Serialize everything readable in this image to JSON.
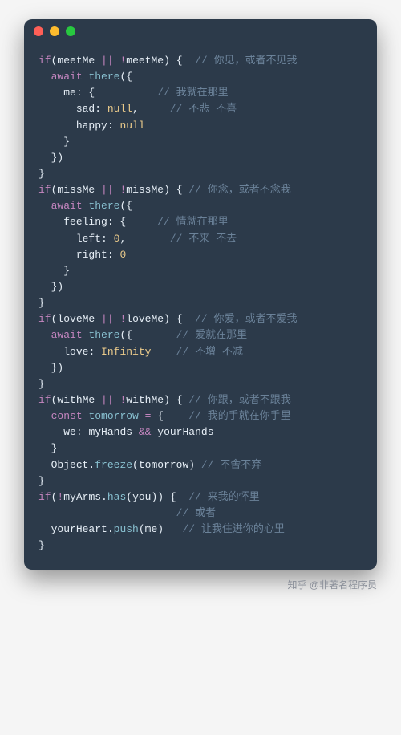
{
  "window": {
    "traffic_lights": [
      "red",
      "yellow",
      "green"
    ]
  },
  "code": {
    "lines": [
      {
        "tokens": [
          [
            "kw",
            "if"
          ],
          [
            "pun",
            "("
          ],
          [
            "id",
            "meetMe"
          ],
          [
            "pun",
            " "
          ],
          [
            "op",
            "||"
          ],
          [
            "pun",
            " "
          ],
          [
            "op",
            "!"
          ],
          [
            "id",
            "meetMe"
          ],
          [
            "pun",
            ") {"
          ]
        ],
        "cmt": "  // 你见，或者不见我"
      },
      {
        "tokens": [
          [
            "pun",
            "  "
          ],
          [
            "kw",
            "await"
          ],
          [
            "pun",
            " "
          ],
          [
            "fn",
            "there"
          ],
          [
            "pun",
            "({"
          ]
        ],
        "cmt": ""
      },
      {
        "tokens": [
          [
            "pun",
            "    "
          ],
          [
            "id",
            "me"
          ],
          [
            "pun",
            ": {"
          ]
        ],
        "cmt": "          // 我就在那里"
      },
      {
        "tokens": [
          [
            "pun",
            "      "
          ],
          [
            "id",
            "sad"
          ],
          [
            "pun",
            ": "
          ],
          [
            "num",
            "null"
          ],
          [
            "pun",
            ","
          ]
        ],
        "cmt": "     // 不悲 不喜"
      },
      {
        "tokens": [
          [
            "pun",
            "      "
          ],
          [
            "id",
            "happy"
          ],
          [
            "pun",
            ": "
          ],
          [
            "num",
            "null"
          ]
        ],
        "cmt": ""
      },
      {
        "tokens": [
          [
            "pun",
            "    }"
          ]
        ],
        "cmt": ""
      },
      {
        "tokens": [
          [
            "pun",
            "  })"
          ]
        ],
        "cmt": ""
      },
      {
        "tokens": [
          [
            "pun",
            "}"
          ]
        ],
        "cmt": ""
      },
      {
        "tokens": [
          [
            "pun",
            ""
          ]
        ],
        "cmt": ""
      },
      {
        "tokens": [
          [
            "kw",
            "if"
          ],
          [
            "pun",
            "("
          ],
          [
            "id",
            "missMe"
          ],
          [
            "pun",
            " "
          ],
          [
            "op",
            "||"
          ],
          [
            "pun",
            " "
          ],
          [
            "op",
            "!"
          ],
          [
            "id",
            "missMe"
          ],
          [
            "pun",
            ") {"
          ]
        ],
        "cmt": " // 你念，或者不念我"
      },
      {
        "tokens": [
          [
            "pun",
            "  "
          ],
          [
            "kw",
            "await"
          ],
          [
            "pun",
            " "
          ],
          [
            "fn",
            "there"
          ],
          [
            "pun",
            "({"
          ]
        ],
        "cmt": ""
      },
      {
        "tokens": [
          [
            "pun",
            "    "
          ],
          [
            "id",
            "feeling"
          ],
          [
            "pun",
            ": {"
          ]
        ],
        "cmt": "     // 情就在那里"
      },
      {
        "tokens": [
          [
            "pun",
            "      "
          ],
          [
            "id",
            "left"
          ],
          [
            "pun",
            ": "
          ],
          [
            "num",
            "0"
          ],
          [
            "pun",
            ","
          ]
        ],
        "cmt": "       // 不来 不去"
      },
      {
        "tokens": [
          [
            "pun",
            "      "
          ],
          [
            "id",
            "right"
          ],
          [
            "pun",
            ": "
          ],
          [
            "num",
            "0"
          ]
        ],
        "cmt": ""
      },
      {
        "tokens": [
          [
            "pun",
            "    }"
          ]
        ],
        "cmt": ""
      },
      {
        "tokens": [
          [
            "pun",
            "  })"
          ]
        ],
        "cmt": ""
      },
      {
        "tokens": [
          [
            "pun",
            "}"
          ]
        ],
        "cmt": ""
      },
      {
        "tokens": [
          [
            "pun",
            ""
          ]
        ],
        "cmt": ""
      },
      {
        "tokens": [
          [
            "kw",
            "if"
          ],
          [
            "pun",
            "("
          ],
          [
            "id",
            "loveMe"
          ],
          [
            "pun",
            " "
          ],
          [
            "op",
            "||"
          ],
          [
            "pun",
            " "
          ],
          [
            "op",
            "!"
          ],
          [
            "id",
            "loveMe"
          ],
          [
            "pun",
            ") {"
          ]
        ],
        "cmt": "  // 你爱，或者不爱我"
      },
      {
        "tokens": [
          [
            "pun",
            "  "
          ],
          [
            "kw",
            "await"
          ],
          [
            "pun",
            " "
          ],
          [
            "fn",
            "there"
          ],
          [
            "pun",
            "({"
          ]
        ],
        "cmt": "       // 爱就在那里"
      },
      {
        "tokens": [
          [
            "pun",
            "    "
          ],
          [
            "id",
            "love"
          ],
          [
            "pun",
            ": "
          ],
          [
            "num",
            "Infinity"
          ]
        ],
        "cmt": "    // 不增 不减"
      },
      {
        "tokens": [
          [
            "pun",
            "  })"
          ]
        ],
        "cmt": ""
      },
      {
        "tokens": [
          [
            "pun",
            "}"
          ]
        ],
        "cmt": ""
      },
      {
        "tokens": [
          [
            "pun",
            ""
          ]
        ],
        "cmt": ""
      },
      {
        "tokens": [
          [
            "kw",
            "if"
          ],
          [
            "pun",
            "("
          ],
          [
            "id",
            "withMe"
          ],
          [
            "pun",
            " "
          ],
          [
            "op",
            "||"
          ],
          [
            "pun",
            " "
          ],
          [
            "op",
            "!"
          ],
          [
            "id",
            "withMe"
          ],
          [
            "pun",
            ") {"
          ]
        ],
        "cmt": " // 你跟，或者不跟我"
      },
      {
        "tokens": [
          [
            "pun",
            "  "
          ],
          [
            "kw",
            "const"
          ],
          [
            "pun",
            " "
          ],
          [
            "fn",
            "tomorrow"
          ],
          [
            "pun",
            " "
          ],
          [
            "op",
            "="
          ],
          [
            "pun",
            " {"
          ]
        ],
        "cmt": "    // 我的手就在你手里"
      },
      {
        "tokens": [
          [
            "pun",
            "    "
          ],
          [
            "id",
            "we"
          ],
          [
            "pun",
            ": "
          ],
          [
            "id",
            "myHands"
          ],
          [
            "pun",
            " "
          ],
          [
            "op",
            "&&"
          ],
          [
            "pun",
            " "
          ],
          [
            "id",
            "yourHands"
          ]
        ],
        "cmt": ""
      },
      {
        "tokens": [
          [
            "pun",
            "  }"
          ]
        ],
        "cmt": ""
      },
      {
        "tokens": [
          [
            "pun",
            "  "
          ],
          [
            "id",
            "Object"
          ],
          [
            "pun",
            "."
          ],
          [
            "fn",
            "freeze"
          ],
          [
            "pun",
            "("
          ],
          [
            "id",
            "tomorrow"
          ],
          [
            "pun",
            ")"
          ]
        ],
        "cmt": " // 不舍不弃"
      },
      {
        "tokens": [
          [
            "pun",
            "}"
          ]
        ],
        "cmt": ""
      },
      {
        "tokens": [
          [
            "pun",
            ""
          ]
        ],
        "cmt": ""
      },
      {
        "tokens": [
          [
            "kw",
            "if"
          ],
          [
            "pun",
            "("
          ],
          [
            "op",
            "!"
          ],
          [
            "id",
            "myArms"
          ],
          [
            "pun",
            "."
          ],
          [
            "fn",
            "has"
          ],
          [
            "pun",
            "("
          ],
          [
            "id",
            "you"
          ],
          [
            "pun",
            ")) {"
          ]
        ],
        "cmt": "  // 来我的怀里"
      },
      {
        "tokens": [
          [
            "pun",
            ""
          ]
        ],
        "cmt": "                      // 或者"
      },
      {
        "tokens": [
          [
            "pun",
            "  "
          ],
          [
            "id",
            "yourHeart"
          ],
          [
            "pun",
            "."
          ],
          [
            "fn",
            "push"
          ],
          [
            "pun",
            "("
          ],
          [
            "id",
            "me"
          ],
          [
            "pun",
            ")"
          ]
        ],
        "cmt": "   // 让我住进你的心里"
      },
      {
        "tokens": [
          [
            "pun",
            "}"
          ]
        ],
        "cmt": ""
      }
    ]
  },
  "footer": {
    "text": "知乎 @非著名程序员"
  }
}
